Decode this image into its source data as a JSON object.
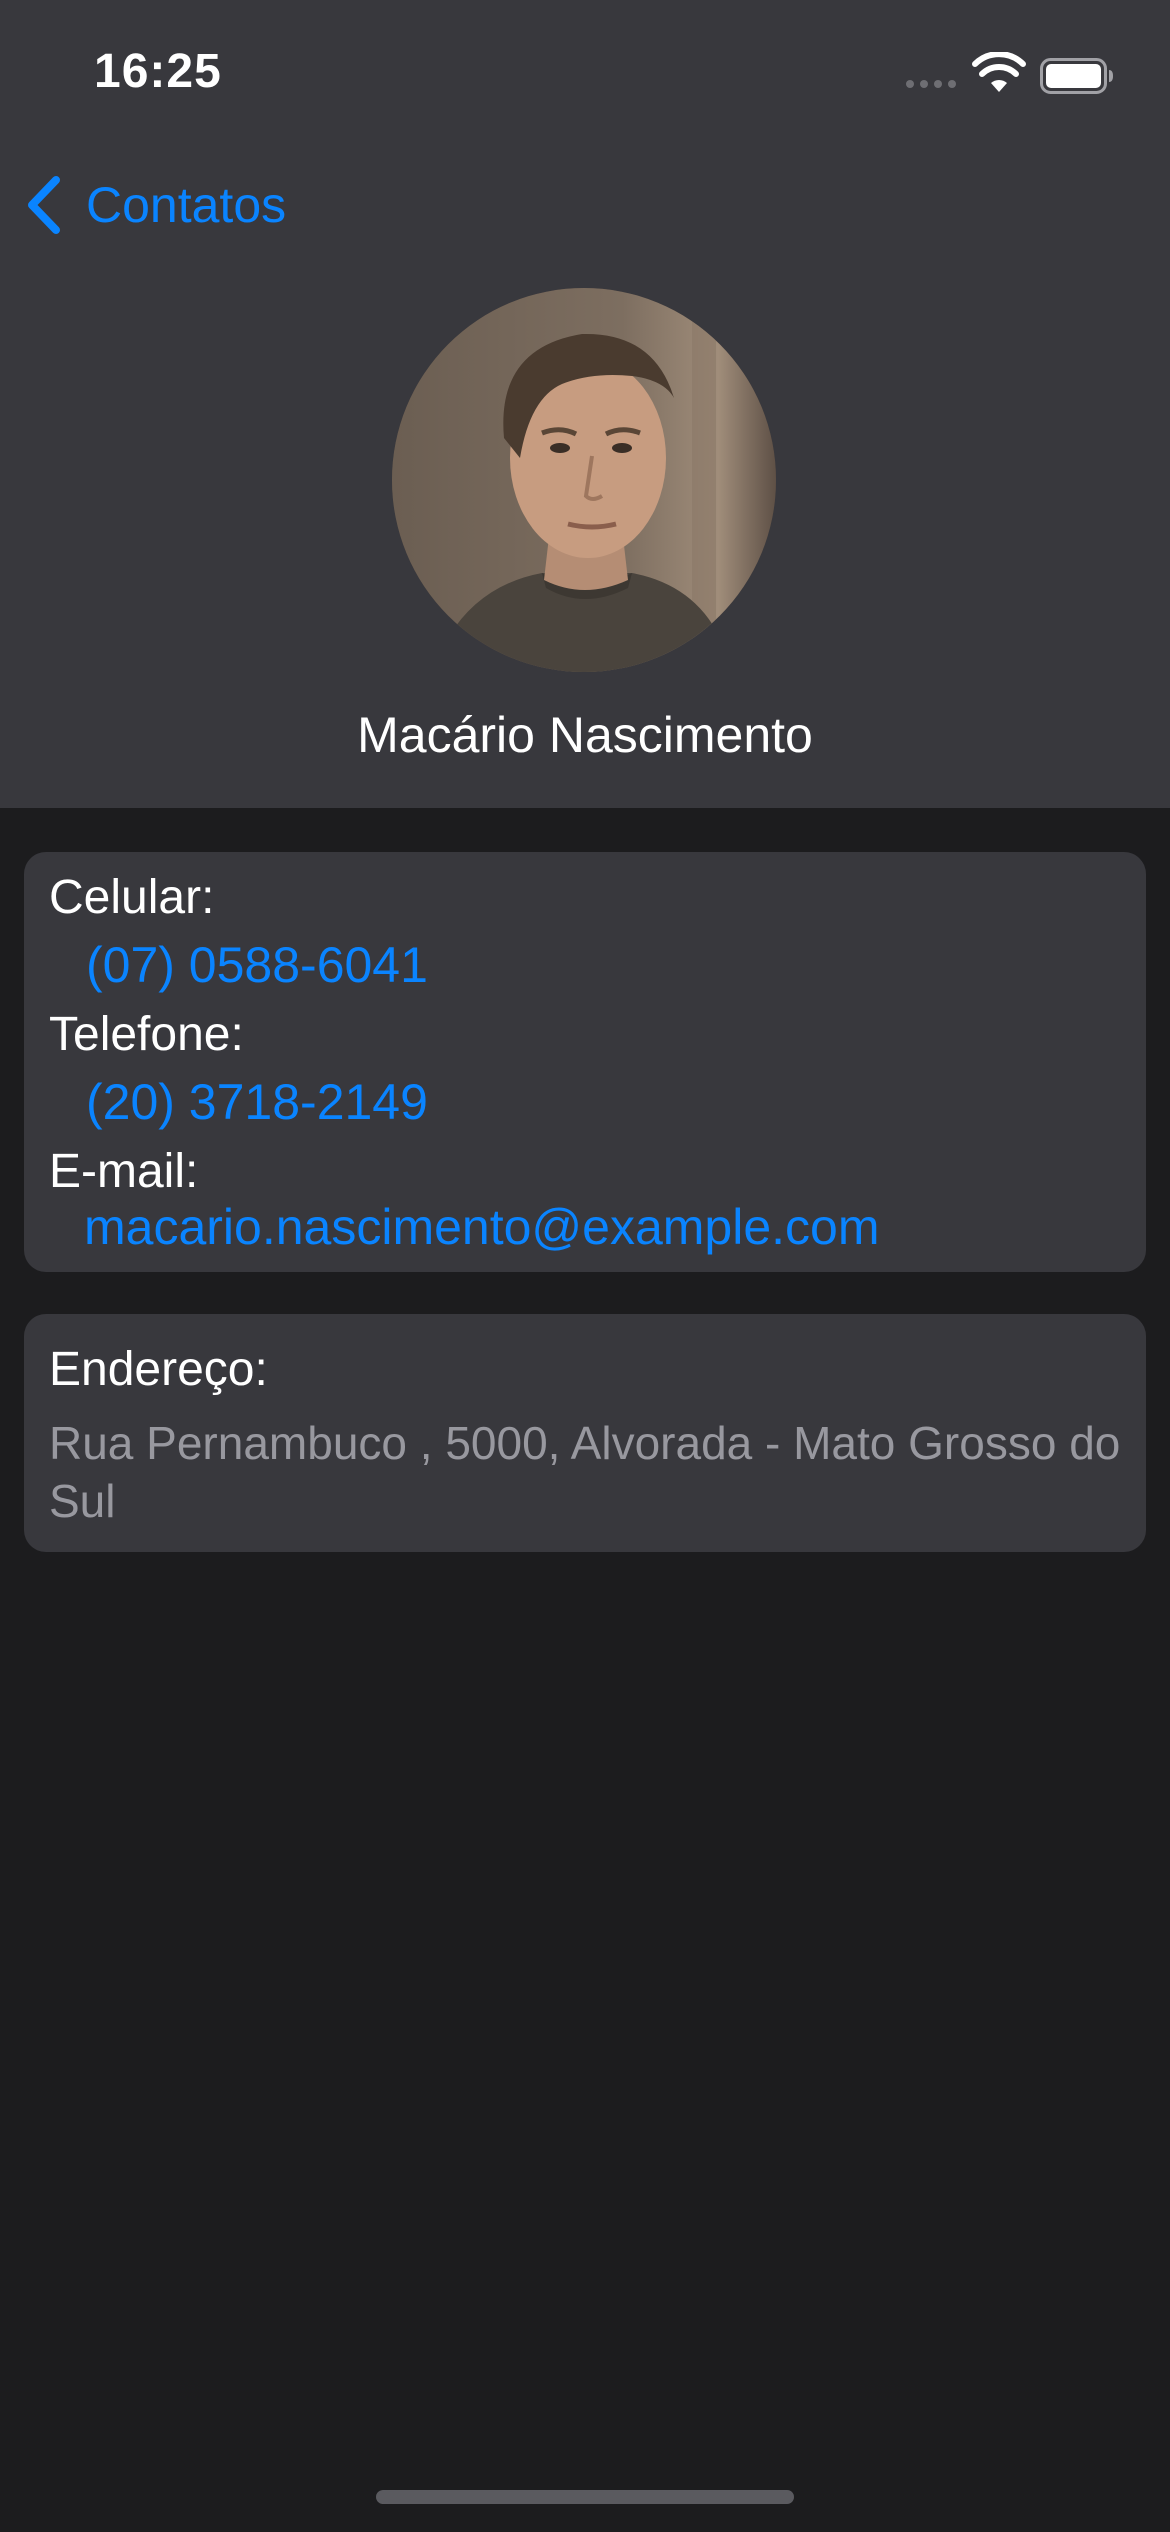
{
  "status_bar": {
    "time": "16:25"
  },
  "nav": {
    "back_label": "Contatos"
  },
  "contact": {
    "name": "Macário Nascimento",
    "fields": [
      {
        "label": "Celular:",
        "value": "(07) 0588-6041"
      },
      {
        "label": "Telefone:",
        "value": "(20) 3718-2149"
      },
      {
        "label": "E-mail:",
        "value": "macario.nascimento@example.com"
      }
    ],
    "address": {
      "label": "Endereço:",
      "value": "Rua Pernambuco , 5000, Alvorada - Mato Grosso do Sul"
    }
  },
  "colors": {
    "accent": "#0a84ff",
    "background": "#1c1c1e",
    "header_background": "#38383d",
    "card_background": "#38383d",
    "secondary_text": "#98989f"
  },
  "icons": {
    "back": "chevron-left-icon",
    "signal": "cellular-signal-icon",
    "wifi": "wifi-icon",
    "battery": "battery-icon"
  }
}
